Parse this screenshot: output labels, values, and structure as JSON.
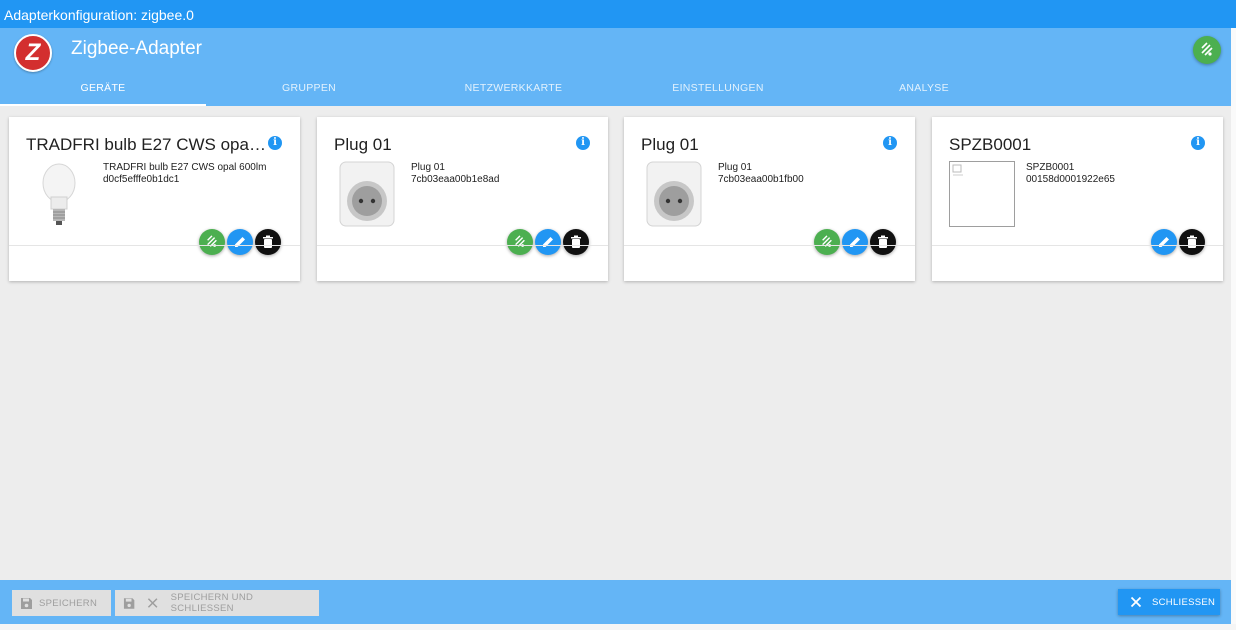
{
  "window": {
    "title": "Adapterkonfiguration: zigbee.0"
  },
  "header": {
    "app_title": "Zigbee-Adapter"
  },
  "tabs": [
    {
      "label": "GERÄTE"
    },
    {
      "label": "GRUPPEN"
    },
    {
      "label": "NETZWERKKARTE"
    },
    {
      "label": "EINSTELLUNGEN"
    },
    {
      "label": "ANALYSE"
    }
  ],
  "devices": [
    {
      "title": "TRADFRI bulb E27 CWS opal 600lm",
      "model": "TRADFRI bulb E27 CWS opal 600lm",
      "id": "d0cf5efffe0b1dc1"
    },
    {
      "title": "Plug 01",
      "model": "Plug 01",
      "id": "7cb03eaa00b1e8ad"
    },
    {
      "title": "Plug 01",
      "model": "Plug 01",
      "id": "7cb03eaa00b1fb00"
    },
    {
      "title": "SPZB0001",
      "model": "SPZB0001",
      "id": "00158d0001922e65"
    }
  ],
  "footer": {
    "save_label": "SPEICHERN",
    "save_close_label": "SPEICHERN UND SCHLIESSEN",
    "close_label": "SCHLIESSEN"
  },
  "colors": {
    "primary": "#2196f3",
    "header": "#64b5f6",
    "green": "#4caf50"
  }
}
